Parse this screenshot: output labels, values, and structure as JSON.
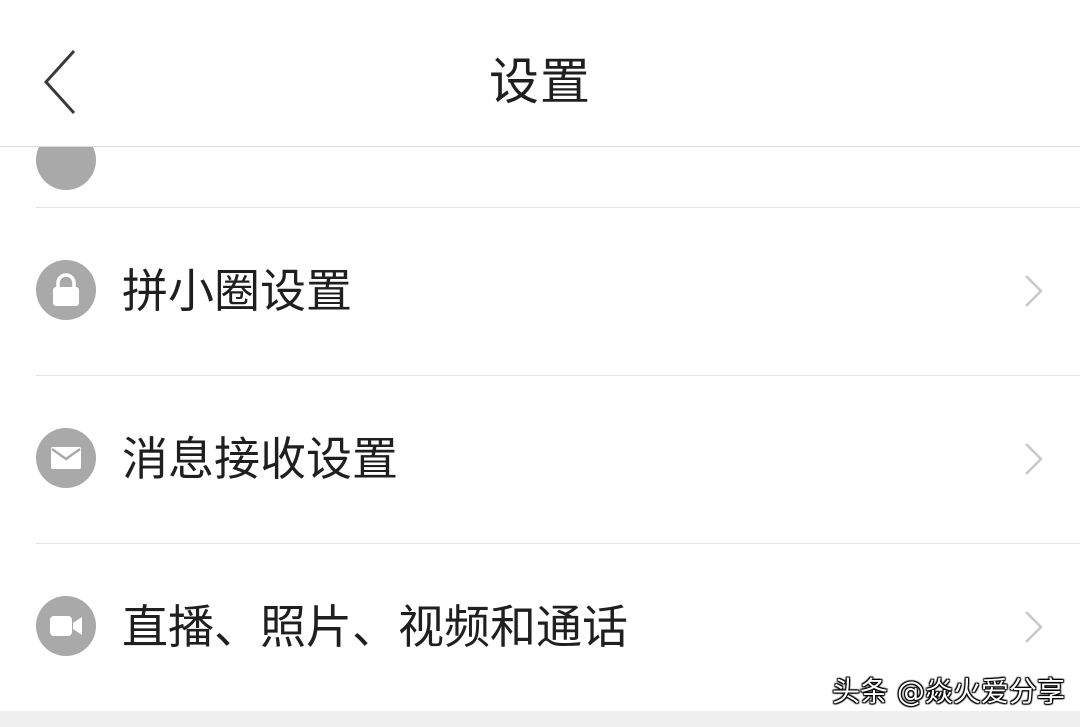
{
  "header": {
    "title": "设置",
    "back_icon": "chevron-left-icon"
  },
  "settings": {
    "items": [
      {
        "label": "拼小圈设置",
        "icon": "lock-icon"
      },
      {
        "label": "消息接收设置",
        "icon": "envelope-icon"
      },
      {
        "label": "直播、照片、视频和通话",
        "icon": "video-camera-icon"
      }
    ]
  },
  "watermark": {
    "text": "头条 @焱火爱分享"
  },
  "colors": {
    "icon_circle": "#a9a9a9",
    "divider": "#e3e3e3",
    "chevron": "#c8c8c8",
    "text": "#1f1f1f"
  }
}
